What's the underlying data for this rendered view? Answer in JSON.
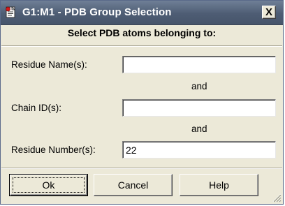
{
  "window": {
    "title": "G1:M1 - PDB Group Selection",
    "close_symbol": "X",
    "icon": "pdb-app-icon"
  },
  "form": {
    "heading": "Select PDB atoms belonging to:",
    "residue_names": {
      "label": "Residue Name(s):",
      "value": ""
    },
    "connector_1": "and",
    "chain_ids": {
      "label": "Chain ID(s):",
      "value": ""
    },
    "connector_2": "and",
    "residue_numbers": {
      "label": "Residue Number(s):",
      "value": "22"
    }
  },
  "buttons": {
    "ok": "Ok",
    "cancel": "Cancel",
    "help": "Help"
  },
  "colors": {
    "titlebar": "#4e5d74",
    "dialog_bg": "#ece9d8"
  }
}
